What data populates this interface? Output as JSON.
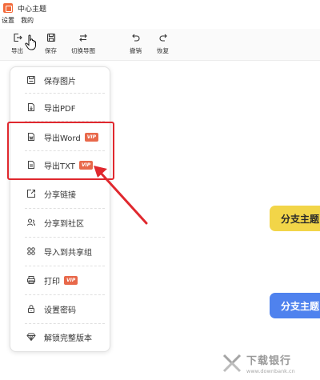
{
  "app": {
    "title": "中心主题"
  },
  "menubar": {
    "items": [
      "设置",
      "我的"
    ]
  },
  "toolbar": {
    "export": {
      "label": "导出",
      "icon": "export-icon"
    },
    "save": {
      "label": "保存",
      "icon": "save-icon"
    },
    "switch_map": {
      "label": "切换导图",
      "icon": "switch-icon"
    },
    "undo": {
      "label": "撤销",
      "icon": "undo-icon"
    },
    "redo": {
      "label": "恢复",
      "icon": "redo-icon"
    }
  },
  "export_menu": {
    "vip_badge": "VIP",
    "items": [
      {
        "label": "保存图片",
        "icon": "image-icon",
        "vip": false
      },
      {
        "label": "导出PDF",
        "icon": "pdf-file-icon",
        "vip": false
      },
      {
        "label": "导出Word",
        "icon": "word-file-icon",
        "vip": true
      },
      {
        "label": "导出TXT",
        "icon": "txt-file-icon",
        "vip": true
      },
      {
        "label": "分享链接",
        "icon": "share-link-icon",
        "vip": false
      },
      {
        "label": "分享到社区",
        "icon": "community-icon",
        "vip": false
      },
      {
        "label": "导入到共享组",
        "icon": "group-icon",
        "vip": false
      },
      {
        "label": "打印",
        "icon": "print-icon",
        "vip": true
      },
      {
        "label": "设置密码",
        "icon": "lock-icon",
        "vip": false
      },
      {
        "label": "解锁完整版本",
        "icon": "unlock-diamond-icon",
        "vip": false
      }
    ]
  },
  "canvas": {
    "nodes": [
      {
        "label": "分支主题",
        "color": "#f2d548"
      },
      {
        "label": "分支主题",
        "color": "#4f82ee"
      }
    ]
  },
  "annotation": {
    "color": "#e0282e"
  },
  "watermark": {
    "cn": "下载银行",
    "en": "www.downbank.cn"
  }
}
